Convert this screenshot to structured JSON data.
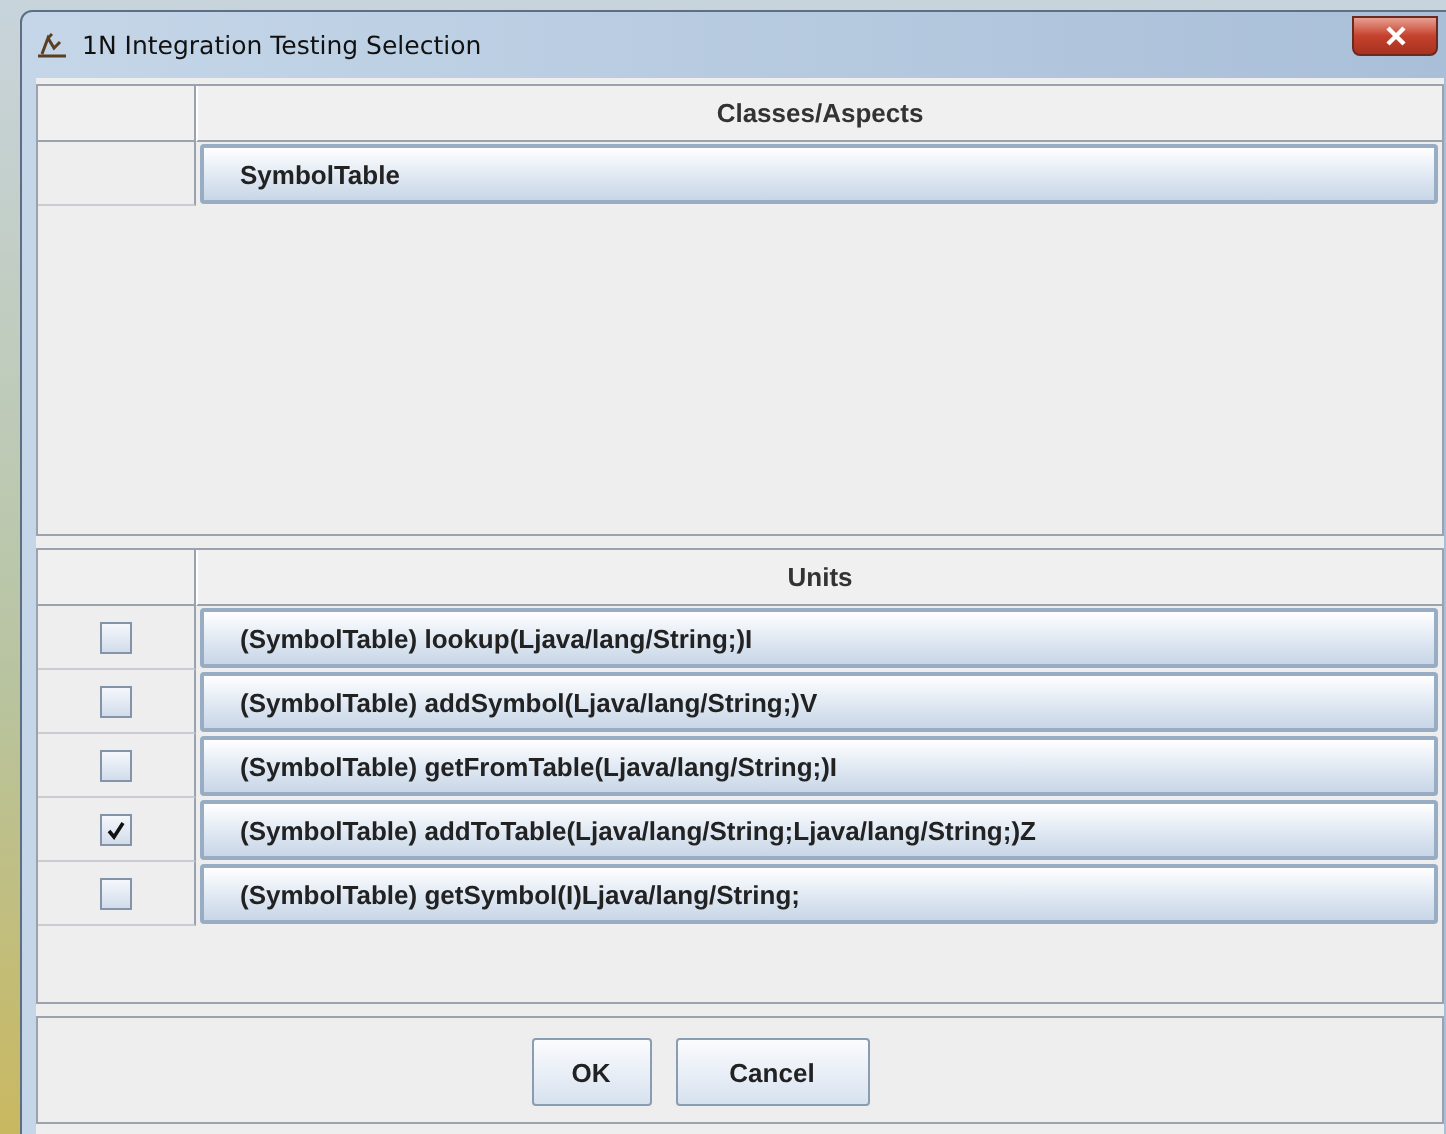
{
  "window": {
    "title": "1N Integration Testing Selection"
  },
  "classes_table": {
    "columns": [
      "Classes/Aspects"
    ],
    "rows": [
      {
        "name": "SymbolTable"
      }
    ]
  },
  "units_table": {
    "columns": [
      "Units"
    ],
    "rows": [
      {
        "checked": false,
        "name": "(SymbolTable) lookup(Ljava/lang/String;)I"
      },
      {
        "checked": false,
        "name": "(SymbolTable) addSymbol(Ljava/lang/String;)V"
      },
      {
        "checked": false,
        "name": "(SymbolTable) getFromTable(Ljava/lang/String;)I"
      },
      {
        "checked": true,
        "name": "(SymbolTable) addToTable(Ljava/lang/String;Ljava/lang/String;)Z"
      },
      {
        "checked": false,
        "name": "(SymbolTable) getSymbol(I)Ljava/lang/String;"
      }
    ]
  },
  "buttons": [
    "OK",
    "Cancel"
  ]
}
